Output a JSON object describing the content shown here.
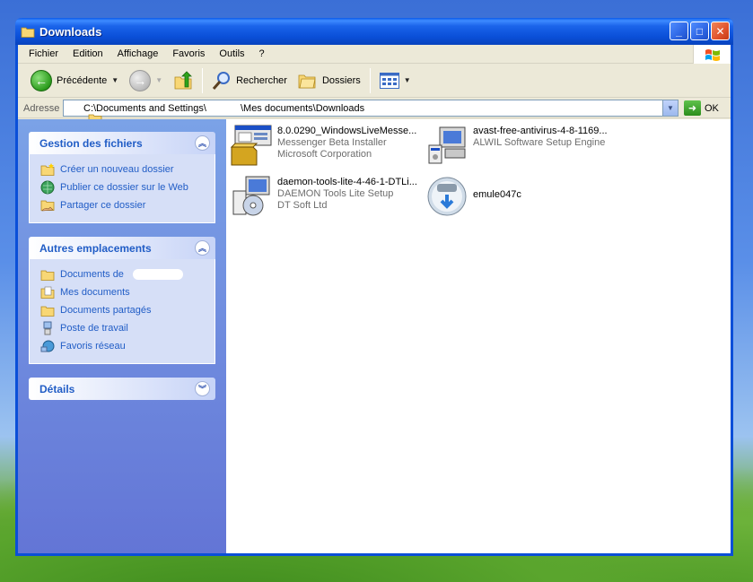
{
  "window": {
    "title": "Downloads"
  },
  "title_buttons": {
    "minimize": "_",
    "maximize": "□",
    "close": "✕"
  },
  "menu": [
    "Fichier",
    "Edition",
    "Affichage",
    "Favoris",
    "Outils",
    "?"
  ],
  "toolbar": {
    "back_label": "Précédente",
    "search_label": "Rechercher",
    "folders_label": "Dossiers"
  },
  "address": {
    "label": "Adresse",
    "path_part1": "C:\\Documents and Settings\\",
    "path_part2": "\\Mes documents\\Downloads",
    "go_label": "OK"
  },
  "tasks": {
    "file_tasks": {
      "title": "Gestion des fichiers",
      "items": [
        "Créer un nouveau dossier",
        "Publier ce dossier sur le Web",
        "Partager ce dossier"
      ]
    },
    "other_places": {
      "title": "Autres emplacements",
      "items": [
        "Documents de",
        "Mes documents",
        "Documents partagés",
        "Poste de travail",
        "Favoris réseau"
      ]
    },
    "details": {
      "title": "Détails"
    }
  },
  "files": [
    {
      "name": "8.0.0290_WindowsLiveMesse...",
      "line2": "Messenger Beta Installer",
      "line3": "Microsoft Corporation"
    },
    {
      "name": "avast-free-antivirus-4-8-1169...",
      "line2": "ALWIL Software Setup Engine",
      "line3": ""
    },
    {
      "name": "daemon-tools-lite-4-46-1-DTLi...",
      "line2": "DAEMON Tools Lite Setup",
      "line3": "DT Soft Ltd"
    },
    {
      "name": "emule047c",
      "line2": "",
      "line3": ""
    }
  ],
  "colors": {
    "titlebar": "#0a4fd8",
    "taskpane": "#6375d6",
    "link": "#215dc6"
  }
}
